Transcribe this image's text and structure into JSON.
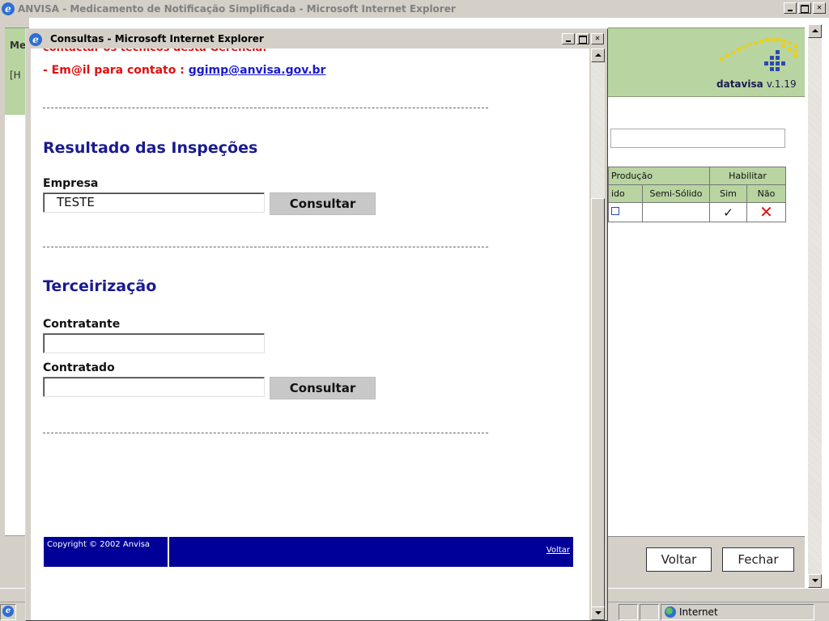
{
  "background_window": {
    "title": "ANVISA - Medicamento de Notificação Simplificada - Microsoft Internet Explorer",
    "strip_label_1": "Me",
    "strip_label_2": "[H",
    "logo": {
      "brand": "datavisa",
      "version": "v.1.19"
    },
    "table": {
      "group_headers": [
        "Produção",
        "Habilitar"
      ],
      "sub_headers": [
        "ido",
        "Semi-Sólido",
        "Sim",
        "Não"
      ]
    },
    "buttons": {
      "voltar": "Voltar",
      "fechar": "Fechar"
    },
    "status": {
      "zone": "Internet"
    }
  },
  "popup": {
    "title": "Consultas - Microsoft Internet Explorer",
    "cut_text": "contactar os técnicos desta Gerência.",
    "email_prefix": "- Em@il para contato : ",
    "email": "ggimp@anvisa.gov.br",
    "section_inspecoes": {
      "title": "Resultado das Inspeções",
      "empresa_label": "Empresa",
      "empresa_value": "TESTE",
      "consultar": "Consultar"
    },
    "section_terceirizacao": {
      "title": "Terceirização",
      "contratante_label": "Contratante",
      "contratante_value": "",
      "contratado_label": "Contratado",
      "contratado_value": "",
      "consultar": "Consultar"
    },
    "footer": {
      "copyright": "Copyright © 2002 Anvisa",
      "voltar": "Voltar"
    }
  }
}
